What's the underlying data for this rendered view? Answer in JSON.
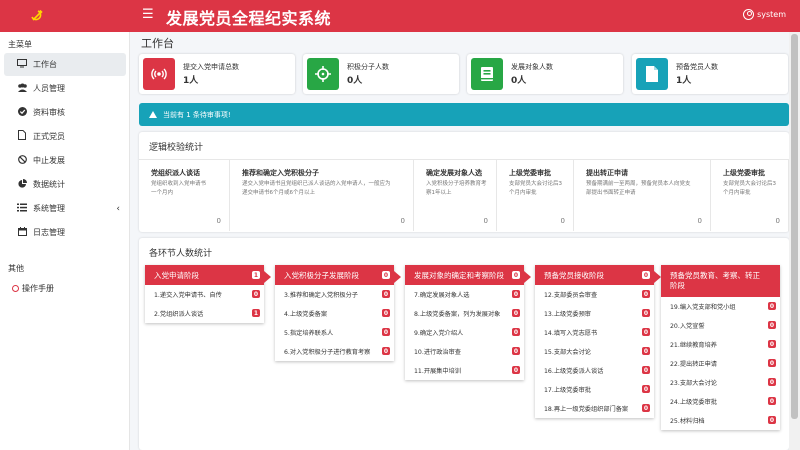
{
  "header": {
    "title": "发展党员全程纪实系统",
    "user": "system"
  },
  "sidebar": {
    "section_main": "主菜单",
    "items": [
      {
        "label": "工作台",
        "icon": "monitor-icon"
      },
      {
        "label": "人员管理",
        "icon": "users-icon"
      },
      {
        "label": "资料审核",
        "icon": "check-circle-icon"
      },
      {
        "label": "正式党员",
        "icon": "file-icon"
      },
      {
        "label": "中止发展",
        "icon": "ban-icon"
      },
      {
        "label": "数据统计",
        "icon": "pie-chart-icon"
      },
      {
        "label": "系统管理",
        "icon": "list-icon"
      },
      {
        "label": "日志管理",
        "icon": "calendar-icon"
      }
    ],
    "section_other": "其他",
    "help": "操作手册"
  },
  "main": {
    "page_title": "工作台",
    "stats": [
      {
        "label": "提交入党申请总数",
        "value": "1人",
        "color": "#dc3545",
        "icon": "broadcast-icon"
      },
      {
        "label": "积极分子人数",
        "value": "0人",
        "color": "#28a745",
        "icon": "crosshairs-icon"
      },
      {
        "label": "发展对象人数",
        "value": "0人",
        "color": "#28a745",
        "icon": "book-icon"
      },
      {
        "label": "预备党员人数",
        "value": "1人",
        "color": "#17a2b8",
        "icon": "document-icon"
      }
    ],
    "alert": "当前有 1 条待审事项!",
    "logic": {
      "title": "逻辑校验统计",
      "columns": [
        {
          "title": "党组织派人谈话",
          "desc": "党组织收到入党申请书\n一个月内",
          "value": "0"
        },
        {
          "title": "推荐和确定入党积极分子",
          "desc": "递交入党申请书且党组织已派人谈话的入党申请人，一般应为\n递交申请书6个月或6个月以上",
          "value": "0"
        },
        {
          "title": "确定发展对象人选",
          "desc": "入党积极分子培养教育考\n察1年以上",
          "value": "0"
        },
        {
          "title": "上级党委审批",
          "desc": "支部党员大会讨论后3\n个月内审批",
          "value": "0"
        },
        {
          "title": "提出转正申请",
          "desc": "预备期满前一至两周，预备党员本人向党支\n部提出书面转正申请",
          "value": "0"
        },
        {
          "title": "上级党委审批",
          "desc": "支部党员大会讨论后3\n个月内审批",
          "value": "0"
        }
      ]
    },
    "stages_title": "各环节人数统计",
    "stages": [
      {
        "title": "入党申请阶段",
        "count": "1",
        "steps": [
          {
            "label": "1.递交入党申请书、自传",
            "count": "0"
          },
          {
            "label": "2.党组织派人谈话",
            "count": "1"
          }
        ]
      },
      {
        "title": "入党积极分子发展阶段",
        "count": "0",
        "steps": [
          {
            "label": "3.推荐和确定入党积极分子",
            "count": "0"
          },
          {
            "label": "4.上级党委备案",
            "count": "0"
          },
          {
            "label": "5.指定培养联系人",
            "count": "0"
          },
          {
            "label": "6.对入党积极分子进行教育考察",
            "count": "0"
          }
        ]
      },
      {
        "title": "发展对象的确定和考察阶段",
        "count": "0",
        "steps": [
          {
            "label": "7.确定发展对象人选",
            "count": "0"
          },
          {
            "label": "8.上级党委备案，列为发展对象",
            "count": "0"
          },
          {
            "label": "9.确定入党介绍人",
            "count": "0"
          },
          {
            "label": "10.进行政治审查",
            "count": "0"
          },
          {
            "label": "11.开展集中培训",
            "count": "0"
          }
        ]
      },
      {
        "title": "预备党员接收阶段",
        "count": "0",
        "steps": [
          {
            "label": "12.支部委员会审查",
            "count": "0"
          },
          {
            "label": "13.上级党委预审",
            "count": "0"
          },
          {
            "label": "14.填写入党志愿书",
            "count": "0"
          },
          {
            "label": "15.支部大会讨论",
            "count": "0"
          },
          {
            "label": "16.上级党委派人谈话",
            "count": "0"
          },
          {
            "label": "17.上级党委审批",
            "count": "0"
          },
          {
            "label": "18.再上一级党委组织部门备案",
            "count": "0"
          }
        ]
      },
      {
        "title": "预备党员教育、考察、转正阶段",
        "count": "",
        "steps": [
          {
            "label": "19.编入党支部和党小组",
            "count": "0"
          },
          {
            "label": "20.入党宣誓",
            "count": "0"
          },
          {
            "label": "21.继续教育培养",
            "count": "0"
          },
          {
            "label": "22.提出转正申请",
            "count": "0"
          },
          {
            "label": "23.支部大会讨论",
            "count": "0"
          },
          {
            "label": "24.上级党委审批",
            "count": "0"
          },
          {
            "label": "25.材料归档",
            "count": "0"
          }
        ]
      }
    ]
  },
  "colors": {
    "brand": "#dc3545",
    "info": "#17a2b8",
    "success": "#28a745"
  }
}
